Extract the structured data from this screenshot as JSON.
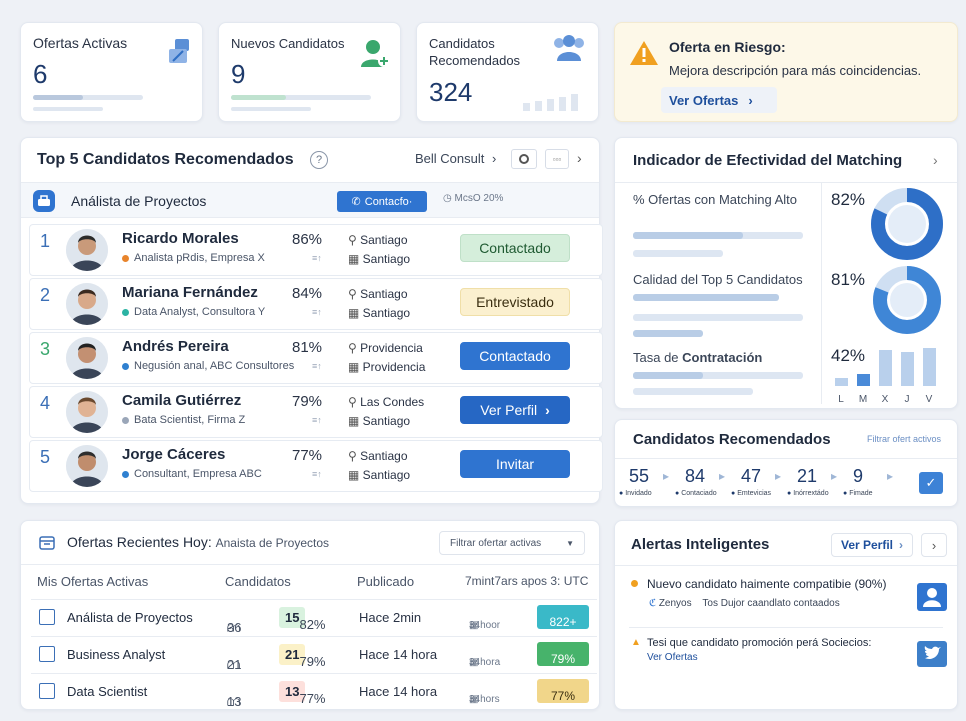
{
  "stats": {
    "ofertas": {
      "title": "Ofertas Activas",
      "value": "6",
      "icon": "briefcase-icon"
    },
    "nuevos": {
      "title": "Nuevos Candidatos",
      "value": "9",
      "icon": "add-user-icon"
    },
    "recomendados": {
      "title1": "Candidatos",
      "title2": "Recomendados",
      "value": "324",
      "icon": "group-icon"
    }
  },
  "risk": {
    "title": "Oferta en Riesgo:",
    "text": "Mejora descripción para más coincidencias.",
    "link": "Ver Ofertas",
    "chev": "›",
    "accent": "#f0a020"
  },
  "top5": {
    "title": "Top 5 Candidatos Recomendados",
    "help": "?",
    "company": "Bell Consult",
    "chev": "›",
    "role": "Análista de Proyectos",
    "contact_btn": "Contacfo·",
    "filter_tag": "McsO 20%",
    "candidates": [
      {
        "rank": "1",
        "name": "Ricardo Morales",
        "role": "Analista pRdis, Empresa X",
        "pct": "86%",
        "mini": "≡↑",
        "loc1": "Santiago",
        "loc2": "Santiago",
        "action": "Contactado",
        "dot": "#e8842c",
        "style": "green"
      },
      {
        "rank": "2",
        "name": "Mariana Fernández",
        "role": "Data Analyst, Consultora Y",
        "pct": "84%",
        "mini": "≡↑",
        "loc1": "Santiago",
        "loc2": "Santiago",
        "action": "Entrevistado",
        "dot": "#2bb3a3",
        "style": "yellow"
      },
      {
        "rank": "3",
        "name": "Andrés Pereira",
        "role": "Negusión anal, ABC Consultores",
        "pct": "81%",
        "mini": "≡↑",
        "loc1": "Providencia",
        "loc2": "Providencia",
        "action": "Contactado",
        "dot": "#2f80d0",
        "style": "blue"
      },
      {
        "rank": "4",
        "name": "Camila Gutiérrez",
        "role": "Bata Scientist, Firma Z",
        "pct": "79%",
        "mini": "≡↑",
        "loc1": "Las Condes",
        "loc2": "Santiago",
        "action": "Ver Perfil",
        "dot": "#9aa6b8",
        "style": "blue-arrow"
      },
      {
        "rank": "5",
        "name": "Jorge Cáceres",
        "role": "Consultant, Empresa ABC",
        "pct": "77%",
        "mini": "≡↑",
        "loc1": "Santiago",
        "loc2": "Santiago",
        "action": "Invitar",
        "dot": "#2f80d0",
        "style": "blue"
      }
    ]
  },
  "matching": {
    "title": "Indicador de Efectividad del Matching",
    "chev": "›",
    "m1_label": "% Ofertas con Matching Alto",
    "m1": 82,
    "m1_text": "82%",
    "m2_label": "Calidad del Top 5 Candidatos",
    "m2": 81,
    "m2_text": "81%",
    "m3_label_a": "Tasa de ",
    "m3_label_b": "Contratación",
    "m3": 42,
    "m3_text": "42%",
    "days": [
      "L",
      "M",
      "X",
      "J",
      "V"
    ],
    "day_values": [
      0.2,
      0.3,
      0.9,
      0.85,
      0.95
    ]
  },
  "funnel": {
    "title": "Candidatos Recomendados",
    "filter": "Filtrar ofert activos",
    "values": [
      "55",
      "84",
      "47",
      "21",
      "9"
    ],
    "labels": [
      "Invidado",
      "Contaciado",
      "Emtevicias",
      "Inórrextádo",
      "Fimade"
    ],
    "arrow": "▸",
    "check": "✓"
  },
  "recent": {
    "title": "Ofertas Recientes Hoy:",
    "subtitle": "Anaista de Proyectos",
    "filter": "Filtrar ofertar activas",
    "headers": [
      "Mis Ofertas Activas",
      "Candidatos",
      "Publicado",
      "7mint7ars apos 3: UTC"
    ],
    "rows": [
      {
        "name": "Análista de Proyectos",
        "count": "36",
        "sep": "-",
        "num": "15",
        "pct": "82%",
        "pub": "Hace 2min",
        "time": "34hoor",
        "badge": "822+",
        "badge_color": "#3ab9c8",
        "pill_color": "#d9f2df"
      },
      {
        "name": "Business Analyst",
        "count": "21",
        "sep": "",
        "num": "21",
        "pct": "79%",
        "pub": "Hace 14 hora",
        "time": "34hora",
        "badge": "79%",
        "badge_color": "#47b36b",
        "pill_color": "#fbf1c8"
      },
      {
        "name": "Data Scientist",
        "count": "13",
        "sep": "",
        "num": "13",
        "pct": "77%",
        "pub": "Hace 14 hora",
        "time": "34hors",
        "badge": "77%",
        "badge_color": "#f1d68a",
        "pill_color": "#fde0dc"
      }
    ]
  },
  "alerts": {
    "title": "Alertas Inteligentes",
    "btn": "Ver Perfil",
    "chev": "›",
    "items": [
      {
        "text": "Nuevo candidato haimente compatibie (90%)",
        "sub1": "Zenyos",
        "sub2": "Tos Dujor caandlato contaados",
        "icon": "user-icon",
        "dot": "#f0a020"
      },
      {
        "text": "Tesi que candidato promoción perá Sociecios:",
        "sub1": "Ver Ofertas",
        "icon": "twitter-icon",
        "dot": "#f0a020"
      }
    ]
  }
}
